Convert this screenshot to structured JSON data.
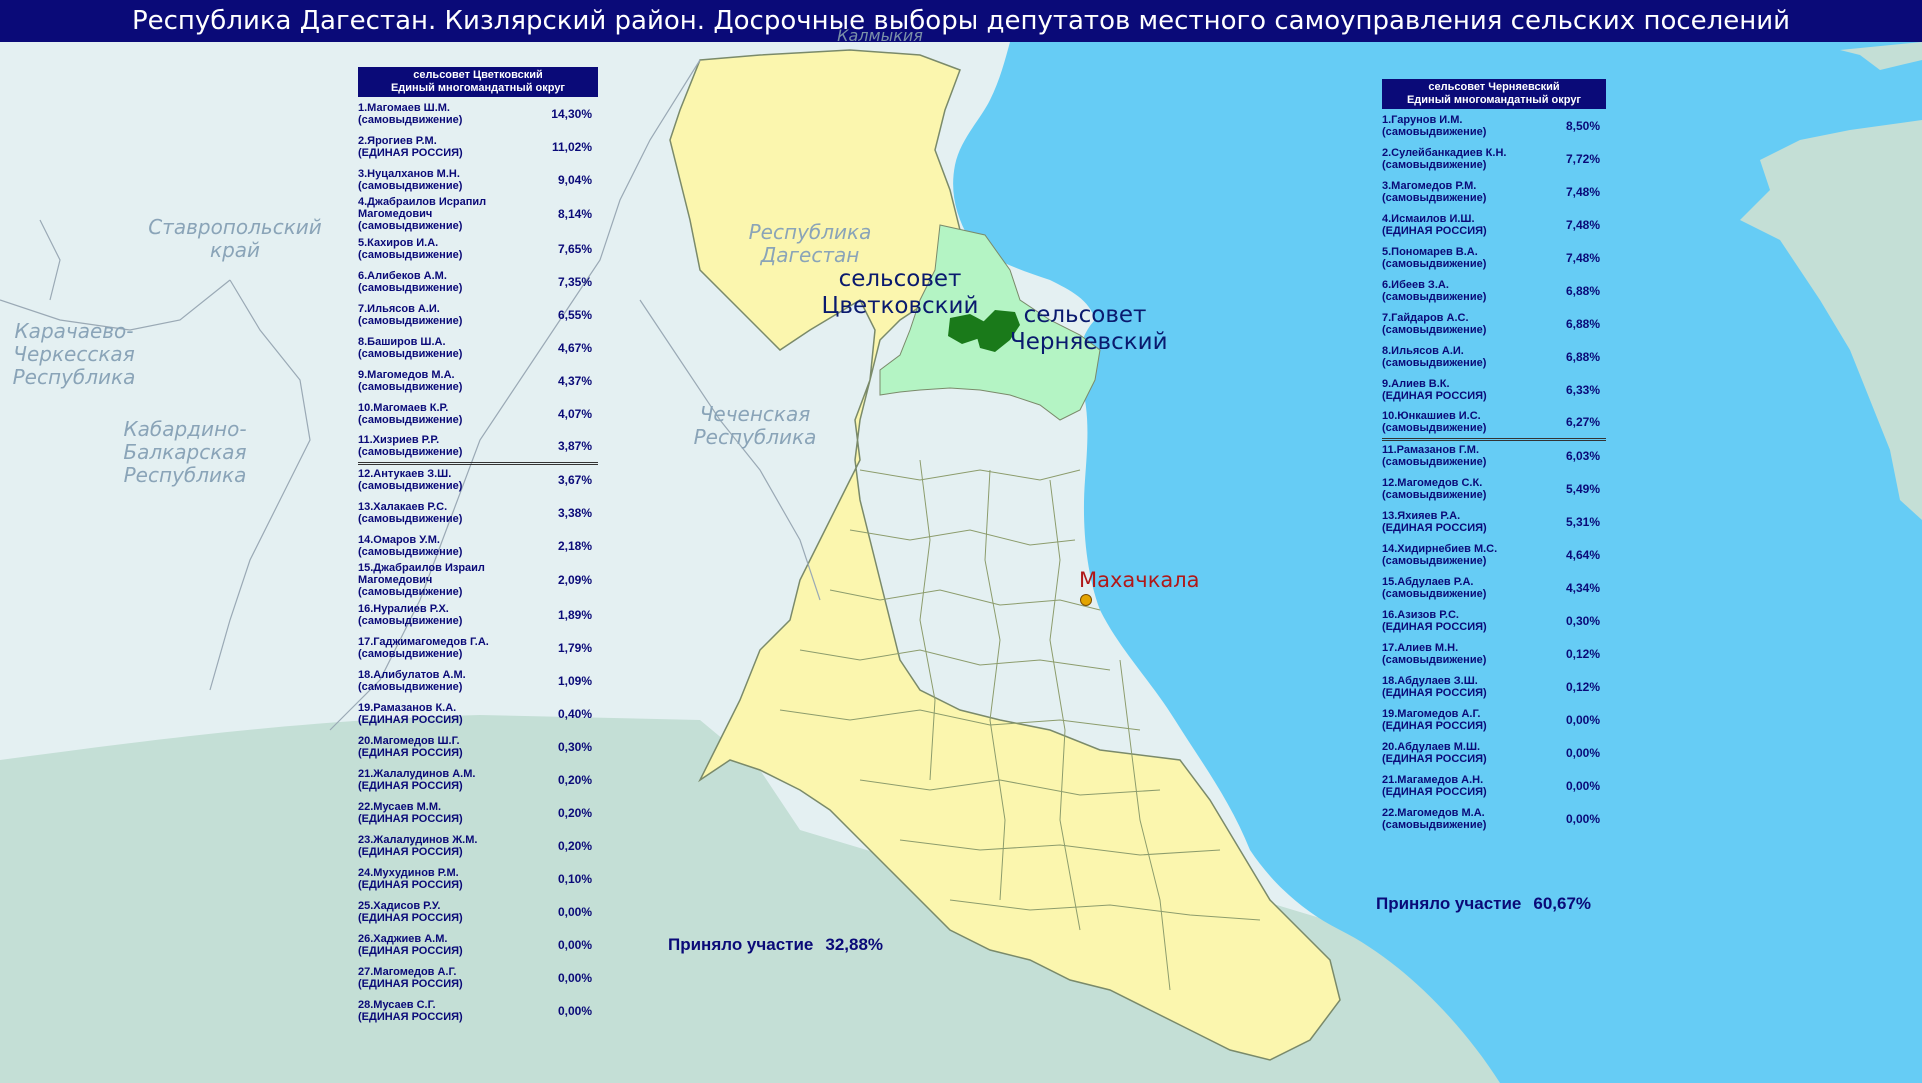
{
  "title": "Республика Дагестан. Кизлярский район. Досрочные выборы депутатов местного самоуправления сельских поселений",
  "colors": {
    "title_bg": "#0a0a78",
    "sea": "#66ccf5",
    "dagestan": "#fbf6ae",
    "kizlyar_district": "#b4f4c4",
    "selsovet": "#1a7a1a",
    "neighbor": "#e4f0f2",
    "foreign": "#c4dfd6"
  },
  "map_labels": {
    "stavropol": "Ставропольский край",
    "kchr": "Карачаево-Черкесская Республика",
    "kbr": "Кабардино-Балкарская Республика",
    "chechnya": "Чеченская Республика",
    "dagestan": "Республика Дагестан",
    "kalmykia": "Калмыкия",
    "tsvetkovsky": "сельсовет Цветковский",
    "chernyaevsky": "сельсовет Черняевский",
    "city": "Махачкала"
  },
  "left_table": {
    "header_line1": "сельсовет Цветковский",
    "header_line2": "Единый многомандатный округ",
    "rows": [
      {
        "name": "1.Магомаев Ш.М.",
        "party": "(самовыдвижение)",
        "pct": "14,30%"
      },
      {
        "name": "2.Ярогиев Р.М.",
        "party": "(ЕДИНАЯ РОССИЯ)",
        "pct": "11,02%"
      },
      {
        "name": "3.Нуцалханов М.Н.",
        "party": "(самовыдвижение)",
        "pct": "9,04%"
      },
      {
        "name": "4.Джабраилов Исрапил Магомедович",
        "party": "(самовыдвижение)",
        "pct": "8,14%"
      },
      {
        "name": "5.Кахиров И.А.",
        "party": "(самовыдвижение)",
        "pct": "7,65%"
      },
      {
        "name": "6.Алибеков А.М.",
        "party": "(самовыдвижение)",
        "pct": "7,35%"
      },
      {
        "name": "7.Ильясов А.И.",
        "party": "(самовыдвижение)",
        "pct": "6,55%"
      },
      {
        "name": "8.Баширов Ш.А.",
        "party": "(самовыдвижение)",
        "pct": "4,67%"
      },
      {
        "name": "9.Магомедов М.А.",
        "party": "(самовыдвижение)",
        "pct": "4,37%"
      },
      {
        "name": "10.Магомаев К.Р.",
        "party": "(самовыдвижение)",
        "pct": "4,07%"
      },
      {
        "name": "11.Хизриев Р.Р.",
        "party": "(самовыдвижение)",
        "pct": "3,87%"
      },
      {
        "name": "12.Антукаев З.Ш.",
        "party": "(самовыдвижение)",
        "pct": "3,67%"
      },
      {
        "name": "13.Халакаев Р.С.",
        "party": "(самовыдвижение)",
        "pct": "3,38%"
      },
      {
        "name": "14.Омаров У.М.",
        "party": "(самовыдвижение)",
        "pct": "2,18%"
      },
      {
        "name": "15.Джабраилов Израил Магомедович",
        "party": "(самовыдвижение)",
        "pct": "2,09%"
      },
      {
        "name": "16.Нуралиев Р.Х.",
        "party": "(самовыдвижение)",
        "pct": "1,89%"
      },
      {
        "name": "17.Гаджимагомедов Г.А.",
        "party": "(самовыдвижение)",
        "pct": "1,79%"
      },
      {
        "name": "18.Алибулатов А.М.",
        "party": "(самовыдвижение)",
        "pct": "1,09%"
      },
      {
        "name": "19.Рамазанов К.А.",
        "party": "(ЕДИНАЯ РОССИЯ)",
        "pct": "0,40%"
      },
      {
        "name": "20.Магомедов Ш.Г.",
        "party": "(ЕДИНАЯ РОССИЯ)",
        "pct": "0,30%"
      },
      {
        "name": "21.Жалалудинов А.М.",
        "party": "(ЕДИНАЯ РОССИЯ)",
        "pct": "0,20%"
      },
      {
        "name": "22.Мусаев М.М.",
        "party": "(ЕДИНАЯ РОССИЯ)",
        "pct": "0,20%"
      },
      {
        "name": "23.Жалалудинов Ж.М.",
        "party": "(ЕДИНАЯ РОССИЯ)",
        "pct": "0,20%"
      },
      {
        "name": "24.Мухудинов Р.М.",
        "party": "(ЕДИНАЯ РОССИЯ)",
        "pct": "0,10%"
      },
      {
        "name": "25.Хадисов Р.У.",
        "party": "(ЕДИНАЯ РОССИЯ)",
        "pct": "0,00%"
      },
      {
        "name": "26.Хаджиев А.М.",
        "party": "(ЕДИНАЯ РОССИЯ)",
        "pct": "0,00%"
      },
      {
        "name": "27.Магомедов А.Г.",
        "party": "(ЕДИНАЯ РОССИЯ)",
        "pct": "0,00%"
      },
      {
        "name": "28.Мусаев С.Г.",
        "party": "(ЕДИНАЯ РОССИЯ)",
        "pct": "0,00%"
      }
    ],
    "turnout_label": "Приняло участие",
    "turnout_value": "32,88%"
  },
  "right_table": {
    "header_line1": "сельсовет Черняевский",
    "header_line2": "Единый многомандатный округ",
    "rows": [
      {
        "name": "1.Гарунов И.М.",
        "party": "(самовыдвижение)",
        "pct": "8,50%"
      },
      {
        "name": "2.Сулейбанкадиев К.Н.",
        "party": "(самовыдвижение)",
        "pct": "7,72%"
      },
      {
        "name": "3.Магомедов Р.М.",
        "party": "(самовыдвижение)",
        "pct": "7,48%"
      },
      {
        "name": "4.Исмаилов И.Ш.",
        "party": "(ЕДИНАЯ РОССИЯ)",
        "pct": "7,48%"
      },
      {
        "name": "5.Пономарев В.А.",
        "party": "(самовыдвижение)",
        "pct": "7,48%"
      },
      {
        "name": "6.Ибеев З.А.",
        "party": "(самовыдвижение)",
        "pct": "6,88%"
      },
      {
        "name": "7.Гайдаров А.С.",
        "party": "(самовыдвижение)",
        "pct": "6,88%"
      },
      {
        "name": "8.Ильясов А.И.",
        "party": "(самовыдвижение)",
        "pct": "6,88%"
      },
      {
        "name": "9.Алиев В.К.",
        "party": "(ЕДИНАЯ РОССИЯ)",
        "pct": "6,33%"
      },
      {
        "name": "10.Юнкашиев И.С.",
        "party": "(самовыдвижение)",
        "pct": "6,27%"
      },
      {
        "name": "11.Рамазанов Г.М.",
        "party": "(самовыдвижение)",
        "pct": "6,03%"
      },
      {
        "name": "12.Магомедов С.К.",
        "party": "(самовыдвижение)",
        "pct": "5,49%"
      },
      {
        "name": "13.Яхияев Р.А.",
        "party": "(ЕДИНАЯ РОССИЯ)",
        "pct": "5,31%"
      },
      {
        "name": "14.Хидирнебиев М.С.",
        "party": "(самовыдвижение)",
        "pct": "4,64%"
      },
      {
        "name": "15.Абдулаев Р.А.",
        "party": "(самовыдвижение)",
        "pct": "4,34%"
      },
      {
        "name": "16.Азизов Р.С.",
        "party": "(ЕДИНАЯ РОССИЯ)",
        "pct": "0,30%"
      },
      {
        "name": "17.Алиев М.Н.",
        "party": "(самовыдвижение)",
        "pct": "0,12%"
      },
      {
        "name": "18.Абдулаев З.Ш.",
        "party": "(ЕДИНАЯ РОССИЯ)",
        "pct": "0,12%"
      },
      {
        "name": "19.Магомедов А.Г.",
        "party": "(ЕДИНАЯ РОССИЯ)",
        "pct": "0,00%"
      },
      {
        "name": "20.Абдулаев М.Ш.",
        "party": "(ЕДИНАЯ РОССИЯ)",
        "pct": "0,00%"
      },
      {
        "name": "21.Магамедов А.Н.",
        "party": "(ЕДИНАЯ РОССИЯ)",
        "pct": "0,00%"
      },
      {
        "name": "22.Магомедов М.А.",
        "party": "(самовыдвижение)",
        "pct": "0,00%"
      }
    ],
    "turnout_label": "Приняло участие",
    "turnout_value": "60,67%"
  }
}
